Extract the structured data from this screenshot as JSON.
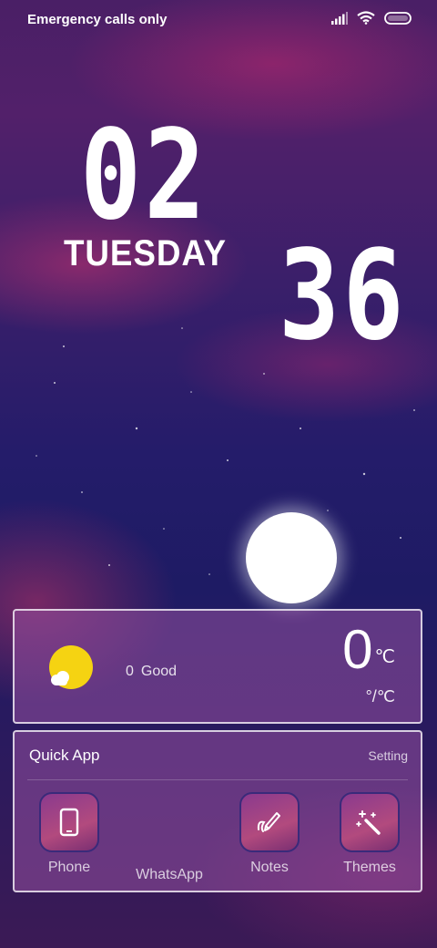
{
  "status_bar": {
    "carrier_text": "Emergency calls only",
    "icons": [
      "signal-icon",
      "wifi-icon",
      "battery-icon"
    ]
  },
  "clock": {
    "hour": "02",
    "day": "TUESDAY",
    "minute": "36"
  },
  "weather": {
    "aqi_value": "0",
    "aqi_label": "Good",
    "temperature": "0",
    "temperature_unit": "℃",
    "unit_toggle": "°/℃",
    "icon": "sun-cloud-icon"
  },
  "quick_app": {
    "title": "Quick App",
    "setting_label": "Setting",
    "apps": [
      {
        "label": "Phone",
        "icon": "phone-icon"
      },
      {
        "label": "WhatsApp",
        "icon": ""
      },
      {
        "label": "Notes",
        "icon": "pen-icon"
      },
      {
        "label": "Themes",
        "icon": "magic-wand-icon"
      }
    ]
  },
  "colors": {
    "card_border": "#ffffff",
    "sun_yellow": "#f5d312"
  }
}
